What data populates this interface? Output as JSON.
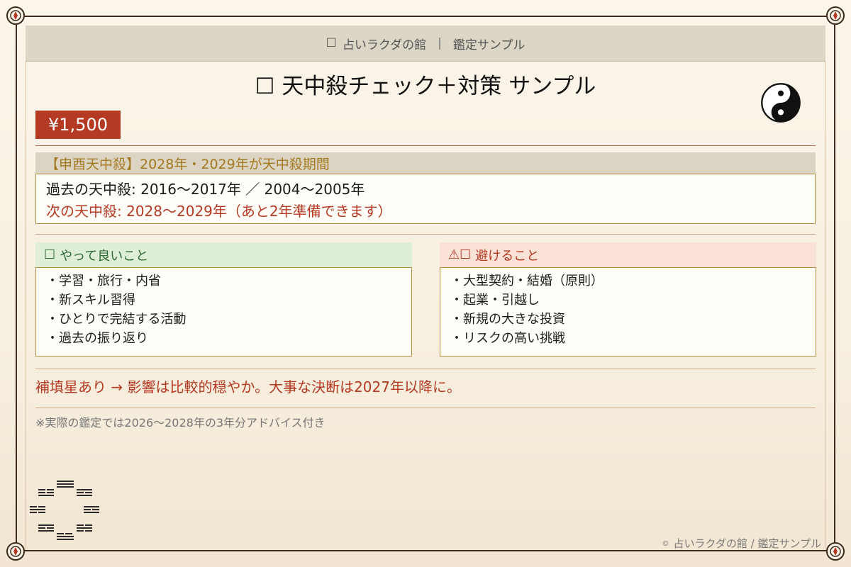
{
  "header": {
    "glyph": "☐",
    "shop": "占いラクダの館",
    "separator": "|",
    "subtitle": "鑑定サンプル"
  },
  "title": {
    "glyph": "☐",
    "text": "天中殺チェック＋対策 サンプル"
  },
  "icons": {
    "yinyang": "yinyang-icon",
    "bagua": "bagua-trigram-icon"
  },
  "price": "¥1,500",
  "period": {
    "heading": "【申酉天中殺】2028年・2029年が天中殺期間",
    "past": "過去の天中殺: 2016〜2017年 ／ 2004〜2005年",
    "next": "次の天中殺: 2028〜2029年（あと2年準備できます）"
  },
  "good": {
    "glyph": "☐",
    "heading": "やって良いこと",
    "items": [
      "・学習・旅行・内省",
      "・新スキル習得",
      "・ひとりで完結する活動",
      "・過去の振り返り"
    ]
  },
  "bad": {
    "glyph": "⚠☐",
    "heading": "避けること",
    "items": [
      "・大型契約・結婚（原則）",
      "・起業・引越し",
      "・新規の大きな投資",
      "・リスクの高い挑戦"
    ]
  },
  "notes": {
    "advice": "補填星あり → 影響は比較的穏やか。大事な決断は2027年以降に。",
    "footnote": "※実際の鑑定では2026〜2028年の3年分アドバイス付き"
  },
  "footer": {
    "copyright_symbol": "©",
    "text": "占いラクダの館 / 鑑定サンプル"
  },
  "colors": {
    "accent_red": "#b53a23",
    "gold": "#a2791f",
    "green": "#2f6a33",
    "frame": "#3c2a1c"
  }
}
